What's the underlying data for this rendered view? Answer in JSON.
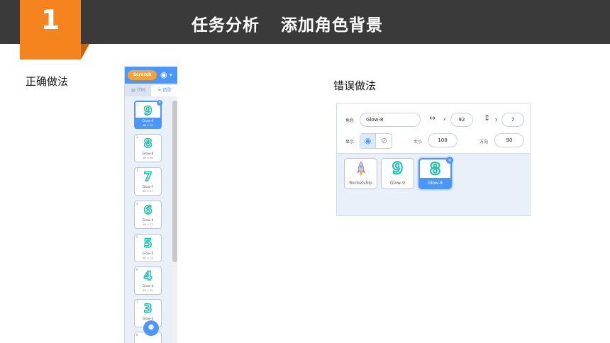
{
  "header": {
    "badge_number": "1",
    "title_part1": "任务分析",
    "title_part2": "添加角色背景"
  },
  "labels": {
    "correct": "正确做法",
    "wrong": "错误做法"
  },
  "left_panel": {
    "logo": "Scratch",
    "globe_icon": "globe-icon",
    "tab_code": "代码",
    "tab_costume": "造型",
    "costumes": [
      {
        "index": "1",
        "glyph": "9",
        "name": "Glow-9",
        "size": "66 × 76"
      },
      {
        "index": "2",
        "glyph": "8",
        "name": "Glow-8",
        "size": "60 × 76"
      },
      {
        "index": "3",
        "glyph": "7",
        "name": "Glow-7",
        "size": "60 × 67"
      },
      {
        "index": "4",
        "glyph": "6",
        "name": "Glow-6",
        "size": "60 × 77"
      },
      {
        "index": "5",
        "glyph": "5",
        "name": "Glow-5",
        "size": "60 × 74"
      },
      {
        "index": "6",
        "glyph": "4",
        "name": "Glow-4",
        "size": "64 × 76"
      },
      {
        "index": "7",
        "glyph": "3",
        "name": "Glow-3",
        "size": ""
      },
      {
        "index": "8",
        "glyph": "",
        "name": "",
        "size": ""
      }
    ]
  },
  "right_panel": {
    "sprite_label": "角色",
    "sprite_name": "Glow-8",
    "x_label": "x",
    "x_value": "92",
    "y_label": "y",
    "y_value": "7",
    "show_label": "显示",
    "size_label": "大小",
    "size_value": "100",
    "direction_label": "方向",
    "direction_value": "90",
    "sprites": [
      {
        "name": "Rocketship",
        "glyph": ""
      },
      {
        "name": "Glow-9",
        "glyph": "9"
      },
      {
        "name": "Glow-8",
        "glyph": "8"
      }
    ]
  },
  "colors": {
    "accent": "#4c97ff",
    "badge": "#f5841f",
    "header": "#3a3a3a",
    "glyph_outline": "#1abfb0"
  }
}
